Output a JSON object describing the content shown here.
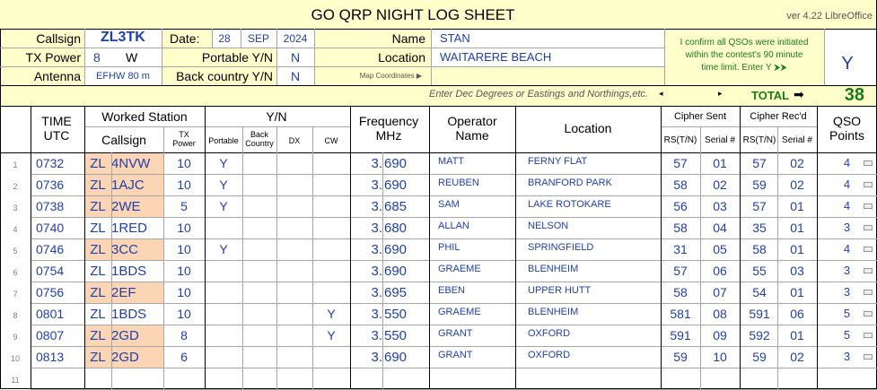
{
  "sheet": {
    "title": "GO  QRP  NIGHT  LOG  SHEET",
    "version": "ver 4.22 LibreOffice",
    "labels": {
      "callsign": "Callsign",
      "date": "Date:",
      "name": "Name",
      "tx_power": "TX Power",
      "power_unit": "W",
      "portable": "Portable Y/N",
      "location": "Location",
      "antenna": "Antenna",
      "back_country": "Back country Y/N",
      "map_coords": "Map Coordinates ▶",
      "coords_hint": "Enter Dec Degrees or Eastings and Northings,etc.",
      "total": "TOTAL",
      "confirm": [
        "I  confirm all QSOs were initiated",
        "within the contest's 90 minute",
        "time limit.      Enter Y  ⮞⮞"
      ]
    },
    "values": {
      "callsign": "ZL3TK",
      "date_day": "28",
      "date_month": "SEP",
      "date_year": "2024",
      "name": "STAN",
      "tx_power": "8",
      "portable": "N",
      "location": "WAITARERE BEACH",
      "antenna": "EFHW 80 m",
      "back_country": "N",
      "confirm": "Y",
      "total": "38"
    }
  },
  "columns": {
    "time": [
      "TIME",
      "UTC"
    ],
    "worked_station": "Worked Station",
    "callsign": "Callsign",
    "tx_power": [
      "TX",
      "Power"
    ],
    "yn": "Y/N",
    "portable": "Portable",
    "back_country": [
      "Back",
      "Country"
    ],
    "dx": "DX",
    "cw": "CW",
    "frequency": [
      "Frequency",
      "MHz"
    ],
    "operator": [
      "Operator",
      "Name"
    ],
    "location": "Location",
    "cipher_sent": "Cipher Sent",
    "cipher_recd": "Cipher Rec'd",
    "rs": "RS(T/N)",
    "serial": "Serial #",
    "qso": [
      "QSO",
      "Points"
    ]
  },
  "rows": [
    {
      "n": "1",
      "time": "0732",
      "pre": "ZL",
      "call": "4NVW",
      "pwr": "10",
      "port": "Y",
      "bc": "",
      "dx": "",
      "cw": "",
      "fa": "3.",
      "fb": "690",
      "op": "MATT",
      "loc": "FERNY FLAT",
      "rs_s": "57",
      "ser_s": "01",
      "rs_r": "57",
      "ser_r": "02",
      "pts": "4",
      "hl": true
    },
    {
      "n": "2",
      "time": "0736",
      "pre": "ZL",
      "call": "1AJC",
      "pwr": "10",
      "port": "Y",
      "bc": "",
      "dx": "",
      "cw": "",
      "fa": "3.",
      "fb": "690",
      "op": "REUBEN",
      "loc": "BRANFORD PARK",
      "rs_s": "58",
      "ser_s": "02",
      "rs_r": "59",
      "ser_r": "02",
      "pts": "4",
      "hl": true
    },
    {
      "n": "3",
      "time": "0738",
      "pre": "ZL",
      "call": "2WE",
      "pwr": "5",
      "port": "Y",
      "bc": "",
      "dx": "",
      "cw": "",
      "fa": "3.",
      "fb": "685",
      "op": "SAM",
      "loc": "LAKE ROTOKARE",
      "rs_s": "56",
      "ser_s": "03",
      "rs_r": "57",
      "ser_r": "01",
      "pts": "4",
      "hl": true
    },
    {
      "n": "4",
      "time": "0740",
      "pre": "ZL",
      "call": "1RED",
      "pwr": "10",
      "port": "",
      "bc": "",
      "dx": "",
      "cw": "",
      "fa": "3.",
      "fb": "680",
      "op": "ALLAN",
      "loc": "NELSON",
      "rs_s": "58",
      "ser_s": "04",
      "rs_r": "35",
      "ser_r": "01",
      "pts": "3",
      "hl": false
    },
    {
      "n": "5",
      "time": "0746",
      "pre": "ZL",
      "call": "3CC",
      "pwr": "10",
      "port": "Y",
      "bc": "",
      "dx": "",
      "cw": "",
      "fa": "3.",
      "fb": "690",
      "op": "PHIL",
      "loc": "SPRINGFIELD",
      "rs_s": "31",
      "ser_s": "05",
      "rs_r": "58",
      "ser_r": "01",
      "pts": "4",
      "hl": true
    },
    {
      "n": "6",
      "time": "0754",
      "pre": "ZL",
      "call": "1BDS",
      "pwr": "10",
      "port": "",
      "bc": "",
      "dx": "",
      "cw": "",
      "fa": "3.",
      "fb": "690",
      "op": "GRAEME",
      "loc": "BLENHEIM",
      "rs_s": "57",
      "ser_s": "06",
      "rs_r": "55",
      "ser_r": "03",
      "pts": "3",
      "hl": false
    },
    {
      "n": "7",
      "time": "0756",
      "pre": "ZL",
      "call": "2EF",
      "pwr": "10",
      "port": "",
      "bc": "",
      "dx": "",
      "cw": "",
      "fa": "3.",
      "fb": "695",
      "op": "EBEN",
      "loc": "UPPER HUTT",
      "rs_s": "58",
      "ser_s": "07",
      "rs_r": "54",
      "ser_r": "01",
      "pts": "3",
      "hl": true
    },
    {
      "n": "8",
      "time": "0801",
      "pre": "ZL",
      "call": "1BDS",
      "pwr": "10",
      "port": "",
      "bc": "",
      "dx": "",
      "cw": "Y",
      "fa": "3.",
      "fb": "550",
      "op": "GRAEME",
      "loc": "BLENHEIM",
      "rs_s": "581",
      "ser_s": "08",
      "rs_r": "591",
      "ser_r": "06",
      "pts": "5",
      "hl": false
    },
    {
      "n": "9",
      "time": "0807",
      "pre": "ZL",
      "call": "2GD",
      "pwr": "8",
      "port": "",
      "bc": "",
      "dx": "",
      "cw": "Y",
      "fa": "3.",
      "fb": "550",
      "op": "GRANT",
      "loc": "OXFORD",
      "rs_s": "591",
      "ser_s": "09",
      "rs_r": "592",
      "ser_r": "01",
      "pts": "5",
      "hl": true
    },
    {
      "n": "10",
      "time": "0813",
      "pre": "ZL",
      "call": "2GD",
      "pwr": "6",
      "port": "",
      "bc": "",
      "dx": "",
      "cw": "",
      "fa": "3.",
      "fb": "690",
      "op": "GRANT",
      "loc": "OXFORD",
      "rs_s": "59",
      "ser_s": "10",
      "rs_r": "59",
      "ser_r": "02",
      "pts": "3",
      "hl": true
    },
    {
      "n": "11",
      "time": "",
      "pre": "",
      "call": "",
      "pwr": "",
      "port": "",
      "bc": "",
      "dx": "",
      "cw": "",
      "fa": "",
      "fb": "",
      "op": "",
      "loc": "",
      "rs_s": "",
      "ser_s": "",
      "rs_r": "",
      "ser_r": "",
      "pts": "",
      "hl": false
    }
  ],
  "colors": {
    "accent": "#1f3fae",
    "yellow": "#ffffcc",
    "orange": "#fcd5b4",
    "green": "#1a7a1a",
    "grid": "#a6a6a6"
  }
}
